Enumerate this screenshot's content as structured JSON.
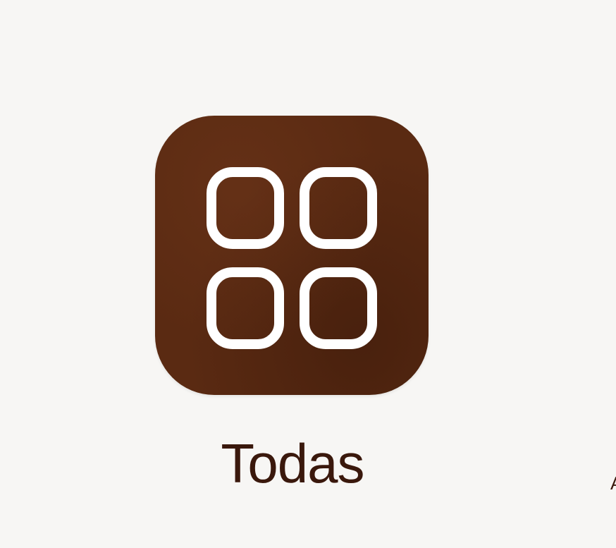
{
  "category": {
    "label": "Todas",
    "icon": "grid-icon",
    "accent_color": "#5a2a12",
    "icon_stroke_color": "#ffffff",
    "label_color": "#3a180c"
  },
  "next_category_partial": {
    "label_fragment": "A"
  }
}
